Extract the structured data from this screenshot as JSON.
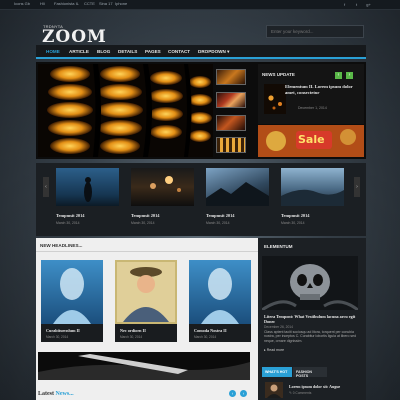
{
  "topbar": {
    "links": [
      "Icons Gb",
      "Hli",
      "Fashionista IL",
      "CCTE",
      "Sina 17",
      "Iphone"
    ],
    "social": [
      "f",
      "t",
      "g+"
    ]
  },
  "brand": {
    "subtitle": "TRDNYTA",
    "logo": "ZOOM"
  },
  "search": {
    "placeholder": "Enter your keyword..."
  },
  "nav": {
    "items": [
      "HOME",
      "ARTICLE",
      "BLOG",
      "DETAILS",
      "PAGES",
      "CONTACT",
      "DROPDOWN ▾"
    ],
    "active_index": 0
  },
  "news_update": {
    "heading": "NEWS UPDATE",
    "prev_arrow": "‹",
    "next_arrow": "›",
    "title": "Elementum II. Lorem ipsum dolor amet, consectetur",
    "date": "December 1, 2014"
  },
  "sale_banner": {
    "text": "Sale"
  },
  "carousel": {
    "prev_arrow": "‹",
    "next_arrow": "›",
    "items": [
      {
        "title": "Tempmsit 2014",
        "date": "March 30, 2014"
      },
      {
        "title": "Tempmsit 2014",
        "date": "March 30, 2014"
      },
      {
        "title": "Tempmsit 2014",
        "date": "March 30, 2014"
      },
      {
        "title": "Tempmsit 2014",
        "date": "March 30, 2014"
      }
    ],
    "page_count": 3,
    "active_page": 0
  },
  "headlines": {
    "heading": "NEW HEADLINES...",
    "cards": [
      {
        "title": "Curabiturcnlum II",
        "date": "March 30, 2014"
      },
      {
        "title": "Nec ordiorn II",
        "date": "March 30, 2014"
      },
      {
        "title": "Comoda Nostra II",
        "date": "March 30, 2014"
      }
    ]
  },
  "latest": {
    "label_plain": "Latest",
    "label_accent": "News...",
    "prev": "‹",
    "next": "›"
  },
  "sidebar": {
    "heading": "ELEMENTUM",
    "featured_title": "Litera Tempont: What Vestibulum lacuna arcu egit Donec",
    "featured_date": "December 26, 2014",
    "featured_body": "Class aptent taciti sociosqu ad litora, torquent per conubia nostra, per inceptos C. Curabitur lobortis ligula at libero sed neque, ornare dignissim.",
    "read_more": "Read more",
    "tabs": [
      "WHAT'S HOT",
      "FASHION POSTS"
    ],
    "active_tab": 0,
    "hot_title": "Lorem ipsum dolor sit: Augue",
    "hot_meta": "0 Comments"
  },
  "colors": {
    "accent": "#2aa0d6",
    "nav_bg": "#16191c",
    "content_bg": "#efefef",
    "sidebar_bg": "#1c2024",
    "green_arrow": "#5ab848"
  }
}
